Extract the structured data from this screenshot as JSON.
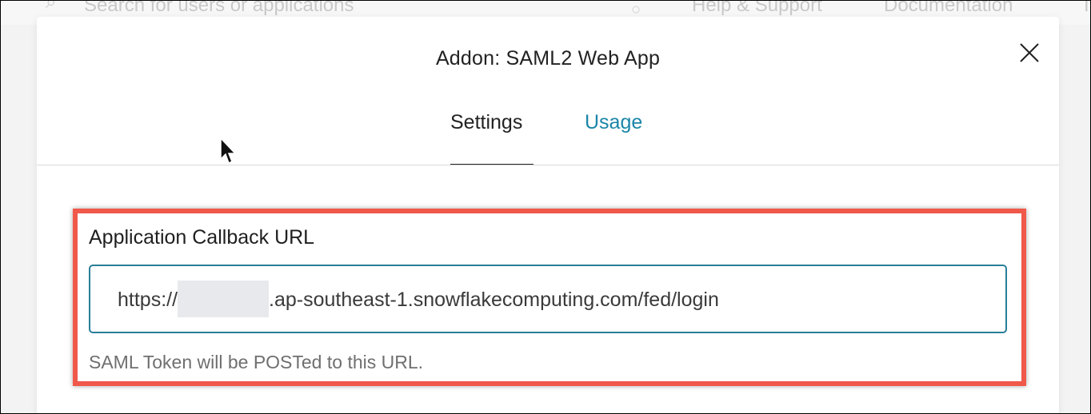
{
  "background": {
    "search_placeholder": "Search for users or applications",
    "help_link": "Help & Support",
    "docs_link": "Documentation",
    "more_link": "T"
  },
  "modal": {
    "title": "Addon: SAML2 Web App",
    "tabs": [
      {
        "label": "Settings",
        "active": true
      },
      {
        "label": "Usage",
        "active": false
      }
    ],
    "callback_field": {
      "label": "Application Callback URL",
      "value_prefix": "https://",
      "value_suffix": ".ap-southeast-1.snowflakecomputing.com/fed/login",
      "hint": "SAML Token will be POSTed to this URL."
    }
  },
  "colors": {
    "accent": "#1a86a8",
    "highlight_border": "#f0584a",
    "input_border": "#2a7f99"
  },
  "icons": {
    "close": "close-icon",
    "cursor": "mouse-pointer-icon",
    "search": "search-icon",
    "lock": "lock-icon"
  }
}
